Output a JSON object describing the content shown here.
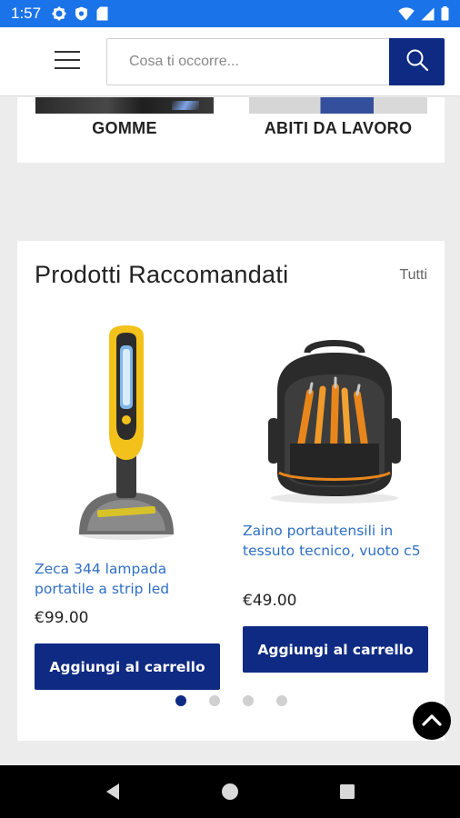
{
  "status_bar": {
    "time": "1:57",
    "left_icons": [
      "gear-icon",
      "shield-icon",
      "sd-card-icon"
    ],
    "right_icons": [
      "wifi-icon",
      "signal-icon",
      "battery-icon"
    ]
  },
  "header": {
    "menu_icon": "hamburger-icon",
    "search": {
      "placeholder": "Cosa ti occorre...",
      "value": ""
    },
    "search_icon": "search-icon"
  },
  "categories": [
    {
      "label": "GOMME"
    },
    {
      "label": "ABITI DA LAVORO"
    }
  ],
  "recommended": {
    "title": "Prodotti Raccomandati",
    "all_link": "Tutti",
    "products": [
      {
        "name": "Zeca 344 lampada portatile a strip led",
        "price": "€99.00",
        "button": "Aggiungi al carrello",
        "image_icon": "lamp-product-icon"
      },
      {
        "name": "Zaino portautensili in tessuto tecnico, vuoto c5",
        "price": "€49.00",
        "button": "Aggiungi al carrello",
        "image_icon": "backpack-product-icon"
      }
    ],
    "carousel": {
      "pages": 4,
      "active_index": 0
    }
  },
  "colors": {
    "brand": "#0e2a82",
    "link": "#2f6fc4",
    "status_bar": "#1a73e8"
  }
}
